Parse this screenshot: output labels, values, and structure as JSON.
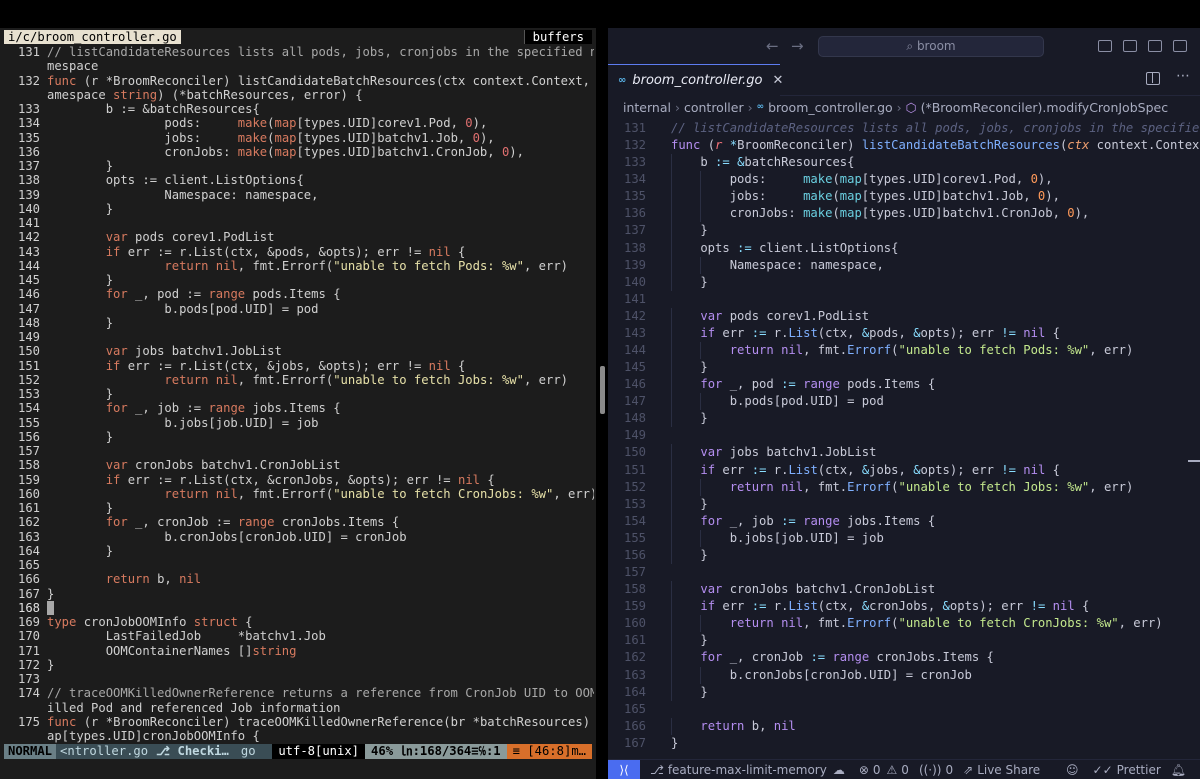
{
  "vim": {
    "filename": "i/c/broom_controller.go",
    "buffers_label": "buffers",
    "lines": [
      {
        "n": "131",
        "t": "// listCandidateResources lists all pods, jobs, cronjobs in the specified na"
      },
      {
        "n": "",
        "t": "mespace"
      },
      {
        "n": "132",
        "t": "func (r *BroomReconciler) listCandidateBatchResources(ctx context.Context, n"
      },
      {
        "n": "",
        "t": "amespace string) (*batchResources, error) {"
      },
      {
        "n": "133",
        "t": "        b := &batchResources{"
      },
      {
        "n": "134",
        "t": "                pods:     make(map[types.UID]corev1.Pod, 0),"
      },
      {
        "n": "135",
        "t": "                jobs:     make(map[types.UID]batchv1.Job, 0),"
      },
      {
        "n": "136",
        "t": "                cronJobs: make(map[types.UID]batchv1.CronJob, 0),"
      },
      {
        "n": "137",
        "t": "        }"
      },
      {
        "n": "138",
        "t": "        opts := client.ListOptions{"
      },
      {
        "n": "139",
        "t": "                Namespace: namespace,"
      },
      {
        "n": "140",
        "t": "        }"
      },
      {
        "n": "141",
        "t": ""
      },
      {
        "n": "142",
        "t": "        var pods corev1.PodList"
      },
      {
        "n": "143",
        "t": "        if err := r.List(ctx, &pods, &opts); err != nil {"
      },
      {
        "n": "144",
        "t": "                return nil, fmt.Errorf(\"unable to fetch Pods: %w\", err)"
      },
      {
        "n": "145",
        "t": "        }"
      },
      {
        "n": "146",
        "t": "        for _, pod := range pods.Items {"
      },
      {
        "n": "147",
        "t": "                b.pods[pod.UID] = pod"
      },
      {
        "n": "148",
        "t": "        }"
      },
      {
        "n": "149",
        "t": ""
      },
      {
        "n": "150",
        "t": "        var jobs batchv1.JobList"
      },
      {
        "n": "151",
        "t": "        if err := r.List(ctx, &jobs, &opts); err != nil {"
      },
      {
        "n": "152",
        "t": "                return nil, fmt.Errorf(\"unable to fetch Jobs: %w\", err)"
      },
      {
        "n": "153",
        "t": "        }"
      },
      {
        "n": "154",
        "t": "        for _, job := range jobs.Items {"
      },
      {
        "n": "155",
        "t": "                b.jobs[job.UID] = job"
      },
      {
        "n": "156",
        "t": "        }"
      },
      {
        "n": "157",
        "t": ""
      },
      {
        "n": "158",
        "t": "        var cronJobs batchv1.CronJobList"
      },
      {
        "n": "159",
        "t": "        if err := r.List(ctx, &cronJobs, &opts); err != nil {"
      },
      {
        "n": "160",
        "t": "                return nil, fmt.Errorf(\"unable to fetch CronJobs: %w\", err)"
      },
      {
        "n": "161",
        "t": "        }"
      },
      {
        "n": "162",
        "t": "        for _, cronJob := range cronJobs.Items {"
      },
      {
        "n": "163",
        "t": "                b.cronJobs[cronJob.UID] = cronJob"
      },
      {
        "n": "164",
        "t": "        }"
      },
      {
        "n": "165",
        "t": ""
      },
      {
        "n": "166",
        "t": "        return b, nil"
      },
      {
        "n": "167",
        "t": "}"
      },
      {
        "n": "168",
        "t": "",
        "cursor": true
      },
      {
        "n": "169",
        "t": "type cronJobOOMInfo struct {"
      },
      {
        "n": "170",
        "t": "        LastFailedJob     *batchv1.Job"
      },
      {
        "n": "171",
        "t": "        OOMContainerNames []string"
      },
      {
        "n": "172",
        "t": "}"
      },
      {
        "n": "173",
        "t": ""
      },
      {
        "n": "174",
        "t": "// traceOOMKilledOwnerReference returns a reference from CronJob UID to OOMK"
      },
      {
        "n": "",
        "t": "illed Pod and referenced Job information"
      },
      {
        "n": "175",
        "t": "func (r *BroomReconciler) traceOOMKilledOwnerReference(br *batchResources) m"
      },
      {
        "n": "",
        "t": "ap[types.UID]cronJobOOMInfo {"
      }
    ],
    "status": {
      "mode": "NORMAL",
      "file": "<ntroller.go",
      "git_icon": "branch-icon",
      "git_label": "Checki…",
      "lang": "go",
      "encoding": "utf-8[unix]",
      "position": "46% ㏑:168/364≡℅:1",
      "warning": "≡ [46:8]m…"
    }
  },
  "vscode": {
    "nav_back": "←",
    "nav_forward": "→",
    "search_placeholder": "broom",
    "tab_title": "broom_controller.go",
    "tab_icon": "go-file-icon",
    "breadcrumb": [
      "internal",
      "controller",
      "broom_controller.go",
      "(*BroomReconciler).modifyCronJobSpec"
    ],
    "lines": [
      {
        "n": "131",
        "t": "// listCandidateResources lists all pods, jobs, cronjobs in the specified nam"
      },
      {
        "n": "132",
        "t": "func (r *BroomReconciler) listCandidateBatchResources(ctx context.Context, na"
      },
      {
        "n": "133",
        "t": "    b := &batchResources{"
      },
      {
        "n": "134",
        "t": "        pods:     make(map[types.UID]corev1.Pod, 0),"
      },
      {
        "n": "135",
        "t": "        jobs:     make(map[types.UID]batchv1.Job, 0),"
      },
      {
        "n": "136",
        "t": "        cronJobs: make(map[types.UID]batchv1.CronJob, 0),"
      },
      {
        "n": "137",
        "t": "    }"
      },
      {
        "n": "138",
        "t": "    opts := client.ListOptions{"
      },
      {
        "n": "139",
        "t": "        Namespace: namespace,"
      },
      {
        "n": "140",
        "t": "    }"
      },
      {
        "n": "141",
        "t": ""
      },
      {
        "n": "142",
        "t": "    var pods corev1.PodList"
      },
      {
        "n": "143",
        "t": "    if err := r.List(ctx, &pods, &opts); err != nil {"
      },
      {
        "n": "144",
        "t": "        return nil, fmt.Errorf(\"unable to fetch Pods: %w\", err)"
      },
      {
        "n": "145",
        "t": "    }"
      },
      {
        "n": "146",
        "t": "    for _, pod := range pods.Items {"
      },
      {
        "n": "147",
        "t": "        b.pods[pod.UID] = pod"
      },
      {
        "n": "148",
        "t": "    }"
      },
      {
        "n": "149",
        "t": ""
      },
      {
        "n": "150",
        "t": "    var jobs batchv1.JobList"
      },
      {
        "n": "151",
        "t": "    if err := r.List(ctx, &jobs, &opts); err != nil {"
      },
      {
        "n": "152",
        "t": "        return nil, fmt.Errorf(\"unable to fetch Jobs: %w\", err)"
      },
      {
        "n": "153",
        "t": "    }"
      },
      {
        "n": "154",
        "t": "    for _, job := range jobs.Items {"
      },
      {
        "n": "155",
        "t": "        b.jobs[job.UID] = job"
      },
      {
        "n": "156",
        "t": "    }"
      },
      {
        "n": "157",
        "t": ""
      },
      {
        "n": "158",
        "t": "    var cronJobs batchv1.CronJobList"
      },
      {
        "n": "159",
        "t": "    if err := r.List(ctx, &cronJobs, &opts); err != nil {"
      },
      {
        "n": "160",
        "t": "        return nil, fmt.Errorf(\"unable to fetch CronJobs: %w\", err)"
      },
      {
        "n": "161",
        "t": "    }"
      },
      {
        "n": "162",
        "t": "    for _, cronJob := range cronJobs.Items {"
      },
      {
        "n": "163",
        "t": "        b.cronJobs[cronJob.UID] = cronJob"
      },
      {
        "n": "164",
        "t": "    }"
      },
      {
        "n": "165",
        "t": ""
      },
      {
        "n": "166",
        "t": "    return b, nil"
      },
      {
        "n": "167",
        "t": "}"
      }
    ],
    "status": {
      "remote_icon": "remote-icon",
      "branch": "feature-max-limit-memory",
      "errors": "0",
      "warnings": "0",
      "ports": "0",
      "live_share": "Live Share",
      "prettier": "Prettier"
    }
  },
  "colors": {
    "vim_bg": "#1c1c1c",
    "vscode_bg": "#181a26",
    "vim_keyword": "#d77a5f",
    "vscode_keyword": "#b48ef0",
    "vscode_function": "#7fb0ff",
    "vscode_type": "#6acfe0",
    "remote_accent": "#4a6cf0"
  }
}
